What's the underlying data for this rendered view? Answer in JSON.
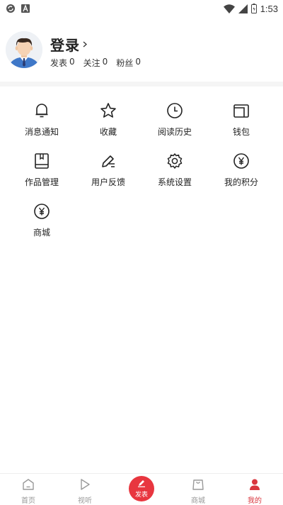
{
  "status_bar": {
    "time": "1:53",
    "left_icons": [
      "sync-icon",
      "a-icon"
    ],
    "right_icons": [
      "wifi-icon",
      "signal-icon",
      "battery-icon"
    ]
  },
  "profile": {
    "title": "登录",
    "stats": [
      {
        "label": "发表",
        "value": "0"
      },
      {
        "label": "关注",
        "value": "0"
      },
      {
        "label": "粉丝",
        "value": "0"
      }
    ]
  },
  "menu": [
    {
      "label": "消息通知",
      "icon": "bell-icon"
    },
    {
      "label": "收藏",
      "icon": "star-icon"
    },
    {
      "label": "阅读历史",
      "icon": "clock-icon"
    },
    {
      "label": "钱包",
      "icon": "wallet-icon"
    },
    {
      "label": "作品管理",
      "icon": "book-icon"
    },
    {
      "label": "用户反馈",
      "icon": "pen-icon"
    },
    {
      "label": "系统设置",
      "icon": "gear-icon"
    },
    {
      "label": "我的积分",
      "icon": "yen-circle-icon"
    },
    {
      "label": "商城",
      "icon": "yen-circle-icon"
    }
  ],
  "tabbar": [
    {
      "label": "首页",
      "icon": "home-icon",
      "active": false
    },
    {
      "label": "视听",
      "icon": "play-icon",
      "active": false
    },
    {
      "label": "发表",
      "icon": "edit-icon",
      "active": false,
      "center": true
    },
    {
      "label": "商城",
      "icon": "bag-icon",
      "active": false
    },
    {
      "label": "我的",
      "icon": "person-icon",
      "active": true
    }
  ],
  "colors": {
    "accent": "#e8363f",
    "active_tab": "#d9373f",
    "inactive_tab": "#999999",
    "divider": "#f5f5f5"
  }
}
